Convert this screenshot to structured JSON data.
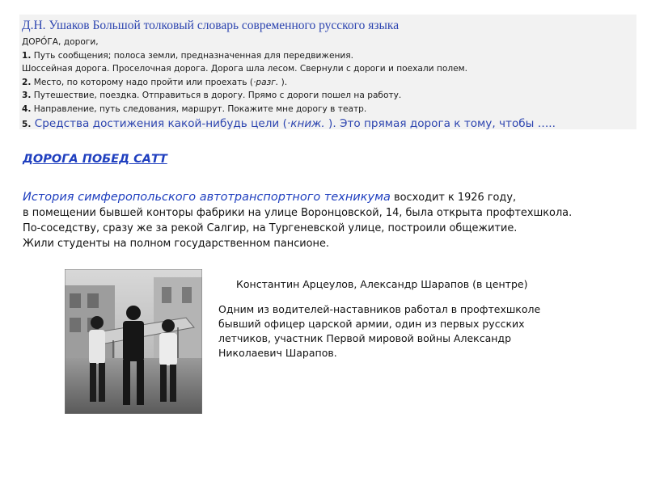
{
  "dictionary": {
    "title": "Д.Н. Ушаков Большой толковый словарь современного русского языка",
    "headword": "ДОРО́ГА, дороги,",
    "senses": [
      {
        "num": "1.",
        "text": " Путь сообщения; полоса земли, предназначенная для передвижения."
      },
      {
        "num": "",
        "text": "Шоссейная дорога. Проселочная дорога. Дорога шла лесом. Свернули с дороги и поехали полем."
      },
      {
        "num": "2.",
        "text": " Место, по которому надо пройти или проехать (",
        "tag": "·разг.",
        "tail": " )."
      },
      {
        "num": "3.",
        "text": " Путешествие, поездка. Отправиться в дорогу. Прямо с дороги пошел на работу."
      },
      {
        "num": "4.",
        "text": " Направление, путь следования, маршрут. Покажите мне дорогу в театр."
      }
    ],
    "last": {
      "num": "5.",
      "text": " Средства достижения какой-нибудь цели (",
      "tag": "·книж.",
      "tail": " ). Это прямая дорога к тому, чтобы ….."
    }
  },
  "heading": "ДОРОГА ПОБЕД  САТТ",
  "history": {
    "lead": "История симферопольского автотранспортного техникума",
    "line1_rest": " восходит к 1926 году,",
    "line2": "в помещении бывшей конторы фабрики на улице Воронцовской, 14, была открыта профтехшкола.",
    "line3": "По-соседству, сразу же за рекой Салгир, на Тургеневской улице, построили общежитие.",
    "line4": "Жили студенты на полном государственном пансионе."
  },
  "photo": {
    "caption": "Константин Арцеулов, Александр Шарапов (в центре)"
  },
  "driver_text": {
    "line1": "Одним из водителей-наставников работал в профтехшколе",
    "line2": "бывший офицер царской армии, один из первых русских",
    "line3": "летчиков, участник Первой мировой войны Александр",
    "line4": "Николаевич Шарапов."
  }
}
